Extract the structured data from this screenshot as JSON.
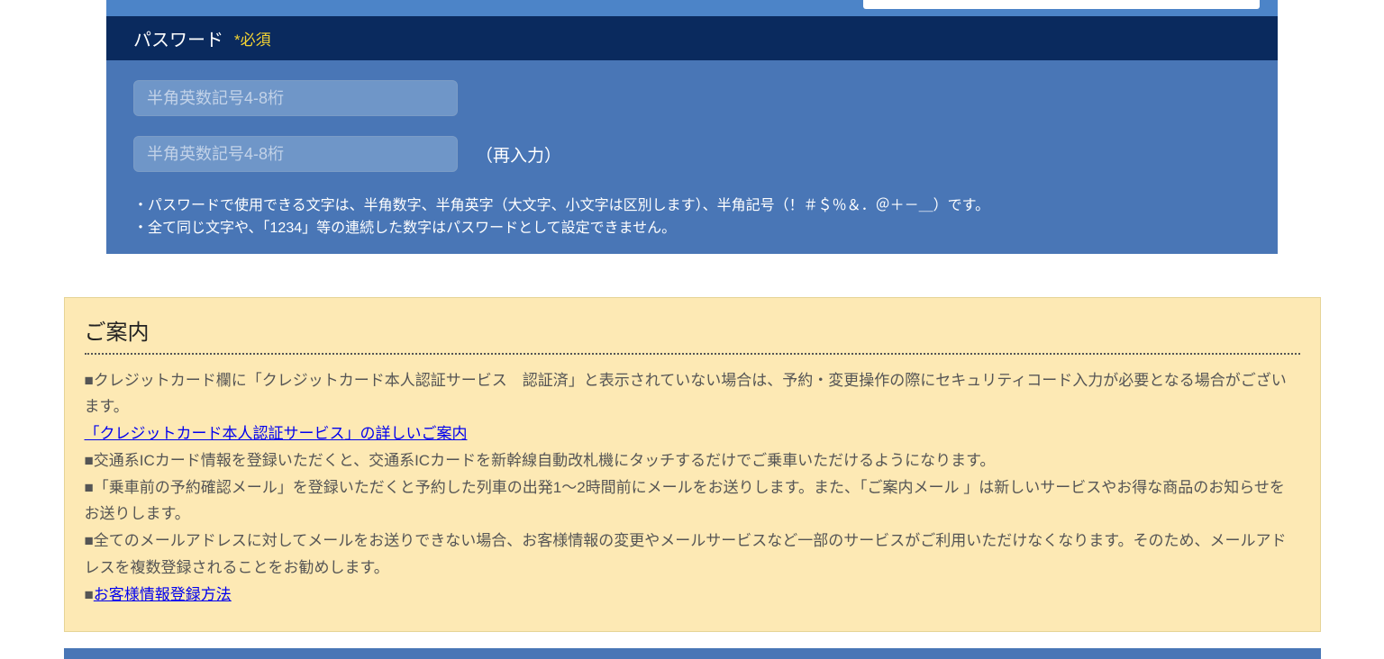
{
  "form": {
    "section": {
      "title": "パスワード",
      "required_label": "*必須"
    },
    "inputs": {
      "password_placeholder": "半角英数記号4-8桁",
      "password_confirm_placeholder": "半角英数記号4-8桁",
      "reentry_label": "（再入力）"
    },
    "hints": [
      "・パスワードで使用できる文字は、半角数字、半角英字（大文字、小文字は区別します）、半角記号（！＃＄％＆．＠＋－＿）です。",
      "・全て同じ文字や、「1234」等の連続した数字はパスワードとして設定できません。"
    ]
  },
  "info": {
    "title": "ご案内",
    "para1": "■クレジットカード欄に「クレジットカード本人認証サービス　認証済」と表示されていない場合は、予約・変更操作の際にセキュリティコード入力が必要となる場合がございます。",
    "link1": "「クレジットカード本人認証サービス」の詳しいご案内",
    "para2": "■交通系ICカード情報を登録いただくと、交通系ICカードを新幹線自動改札機にタッチするだけでご乗車いただけるようになります。",
    "para3": "■「乗車前の予約確認メール」を登録いただくと予約した列車の出発1〜2時間前にメールをお送りします。また、「ご案内メール 」は新しいサービスやお得な商品のお知らせをお送りします。",
    "para4": "■全てのメールアドレスに対してメールをお送りできない場合、お客様情報の変更やメールサービスなど一部のサービスがご利用いただけなくなります。そのため、メールアドレスを複数登録されることをお勧めします。",
    "bullet5": "■",
    "link2": "お客様情報登録方法"
  }
}
